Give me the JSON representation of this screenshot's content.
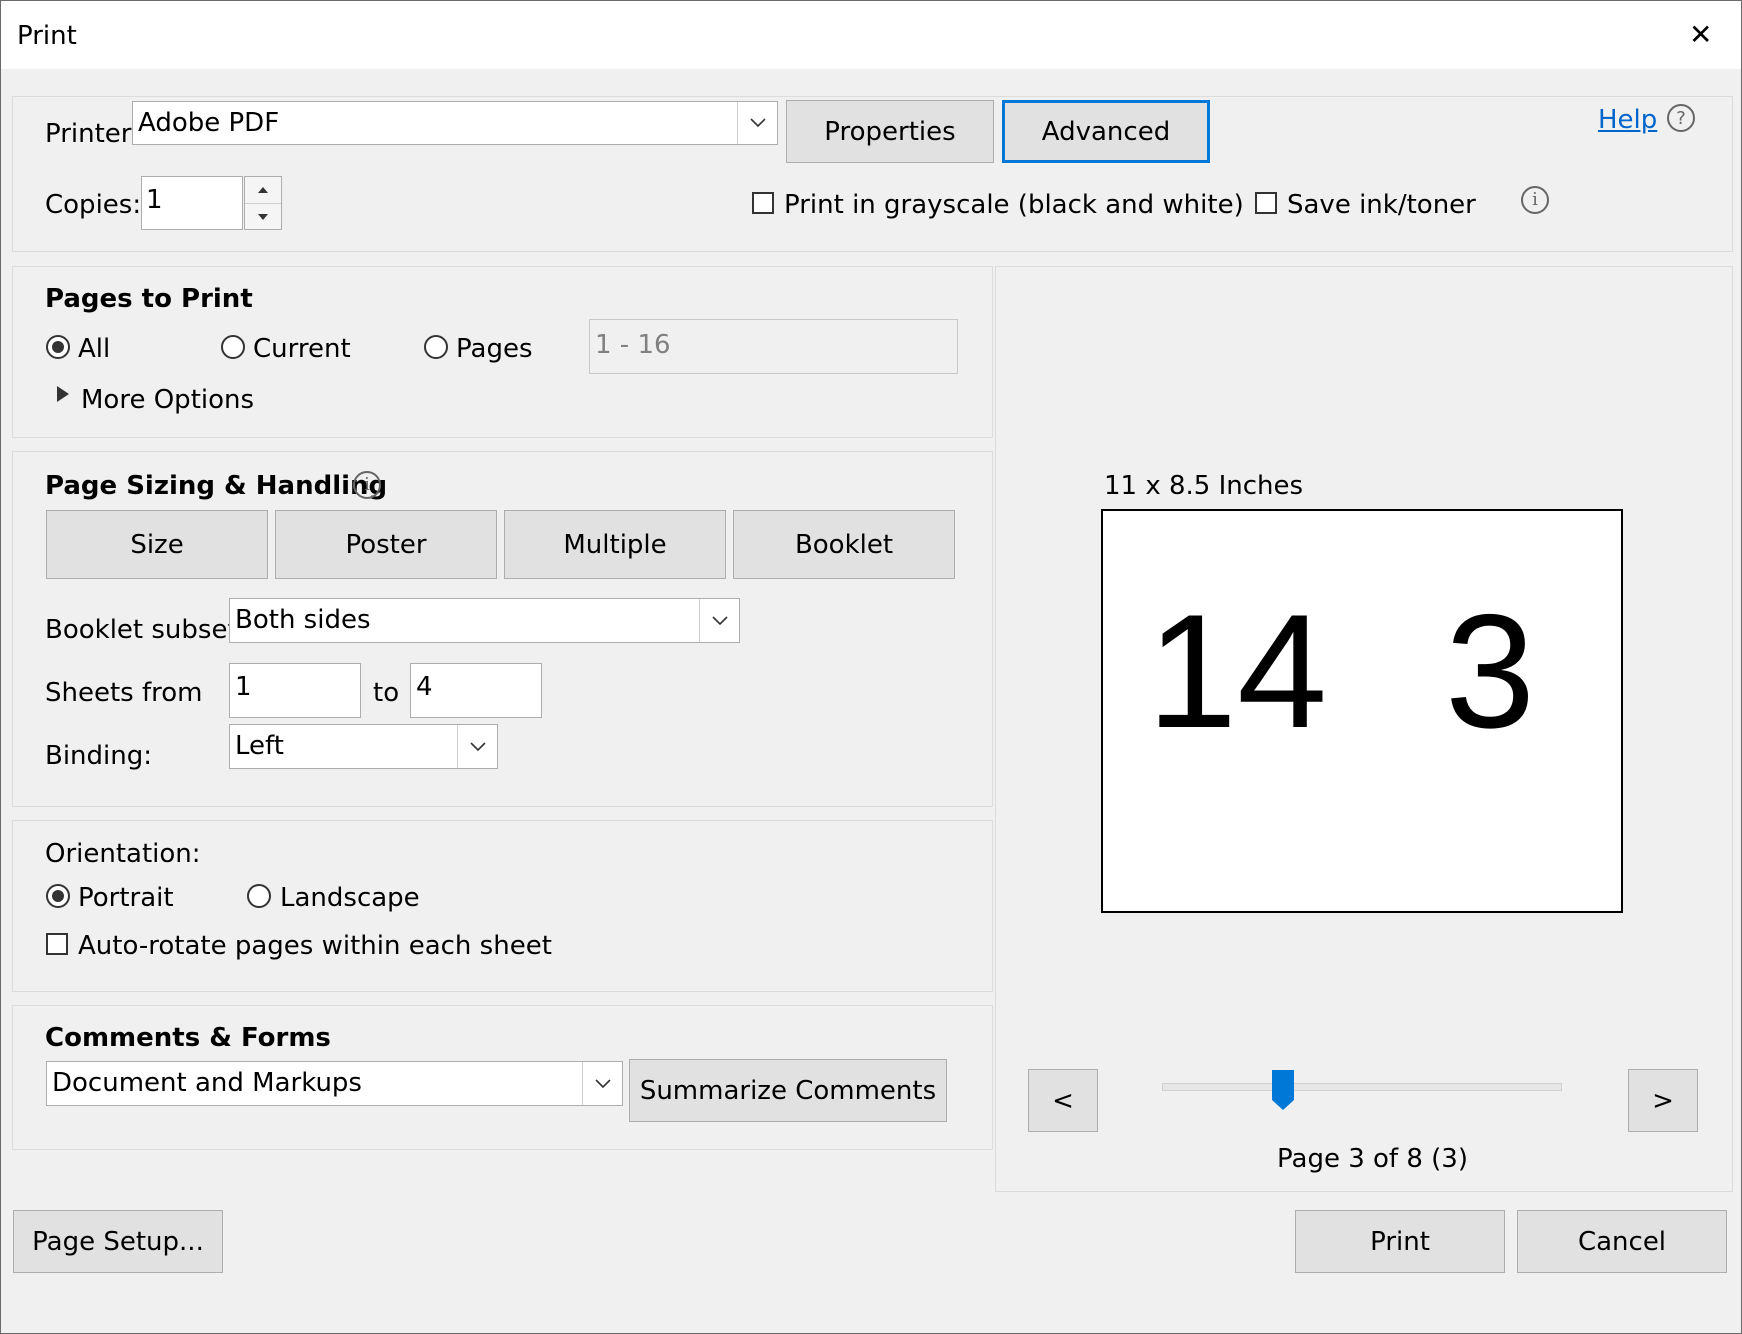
{
  "window": {
    "title": "Print",
    "close_glyph": "✕"
  },
  "printer": {
    "label": "Printer:",
    "value": "Adobe PDF",
    "properties_label": "Properties",
    "advanced_label": "Advanced",
    "help_label": "Help",
    "help_glyph": "?"
  },
  "copies": {
    "label": "Copies:",
    "value": "1"
  },
  "options": {
    "grayscale_label": "Print in grayscale (black and white)",
    "grayscale_checked": false,
    "save_ink_label": "Save ink/toner",
    "save_ink_checked": false,
    "info_glyph": "i"
  },
  "pages_to_print": {
    "heading": "Pages to Print",
    "all_label": "All",
    "current_label": "Current",
    "pages_label": "Pages",
    "pages_value": "1 - 16",
    "selected": "All",
    "more_options_label": "More Options"
  },
  "sizing": {
    "heading": "Page Sizing & Handling",
    "info_glyph": "i",
    "tabs": [
      "Size",
      "Poster",
      "Multiple",
      "Booklet"
    ],
    "booklet_subset_label": "Booklet subset:",
    "booklet_subset_value": "Both sides",
    "sheets_from_label": "Sheets from",
    "sheets_from_value": "1",
    "to_label": "to",
    "sheets_to_value": "4",
    "binding_label": "Binding:",
    "binding_value": "Left"
  },
  "orientation": {
    "label": "Orientation:",
    "portrait_label": "Portrait",
    "landscape_label": "Landscape",
    "selected": "Portrait",
    "auto_rotate_label": "Auto-rotate pages within each sheet",
    "auto_rotate_checked": false
  },
  "comments_forms": {
    "heading": "Comments & Forms",
    "value": "Document and Markups",
    "summarize_label": "Summarize Comments"
  },
  "preview": {
    "size_label": "11 x 8.5 Inches",
    "left_page": "14",
    "right_page": "3",
    "prev_label": "<",
    "next_label": ">",
    "page_status": "Page 3 of 8 (3)",
    "slider_fraction": 0.29
  },
  "footer": {
    "page_setup_label": "Page Setup...",
    "print_label": "Print",
    "cancel_label": "Cancel"
  },
  "colors": {
    "accent": "#0078d7",
    "link": "#0066cc"
  }
}
